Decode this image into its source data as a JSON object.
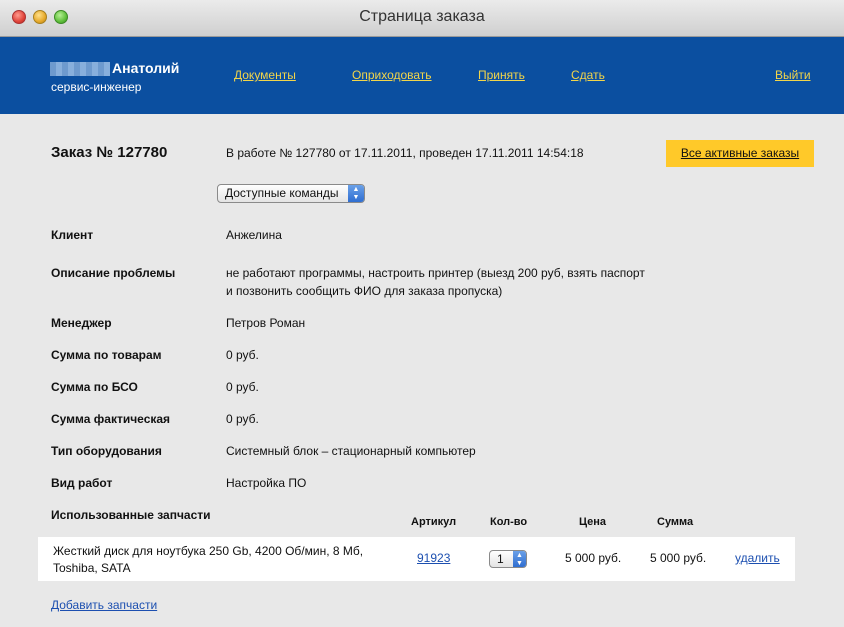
{
  "window": {
    "title": "Страница заказа"
  },
  "user": {
    "name": "Анатолий",
    "role": "сервис-инженер"
  },
  "nav": {
    "documents": "Документы",
    "receive_expense": "Оприходовать",
    "accept": "Принять",
    "hand_over": "Сдать",
    "logout": "Выйти"
  },
  "order": {
    "title": "Заказ № 127780",
    "status": "В работе № 127780 от 17.11.2011, проведен 17.11.2011 14:54:18",
    "all_orders_label": "Все активные заказы",
    "commands_select": "Доступные команды"
  },
  "fields": [
    {
      "label": "Клиент",
      "value": "Анжелина"
    },
    {
      "label": "Описание проблемы",
      "value_line1": "не работают программы, настроить принтер (выезд 200 руб, взять паспорт",
      "value_line2": "и позвонить сообщить ФИО для заказа пропуска)"
    },
    {
      "label": "Менеджер",
      "value": "Петров Роман"
    },
    {
      "label": "Сумма по товарам",
      "value": "0 руб."
    },
    {
      "label": "Сумма по БСО",
      "value": "0 руб."
    },
    {
      "label": "Сумма фактическая",
      "value": "0 руб."
    },
    {
      "label": "Тип оборудования",
      "value": "Системный блок – стационарный компьютер"
    },
    {
      "label": "Вид работ",
      "value": "Настройка ПО"
    }
  ],
  "parts": {
    "label": "Использованные запчасти",
    "columns": {
      "article": "Артикул",
      "qty": "Кол-во",
      "price": "Цена",
      "sum": "Сумма"
    },
    "rows": [
      {
        "name_line1": "Жесткий диск для ноутбука 250 Gb, 4200 Об/мин, 8 Мб,",
        "name_line2": "Toshiba, SATA",
        "article": "91923",
        "qty": "1",
        "price": "5 000 руб.",
        "sum": "5 000 руб.",
        "delete_label": "удалить"
      }
    ],
    "add_label": "Добавить запчасти"
  },
  "colors": {
    "header_bg": "#0b4fa0",
    "nav_link": "#f2d54a",
    "accent_button": "#ffc929",
    "link": "#1c4fb0",
    "page_bg": "#e8e8e8"
  }
}
